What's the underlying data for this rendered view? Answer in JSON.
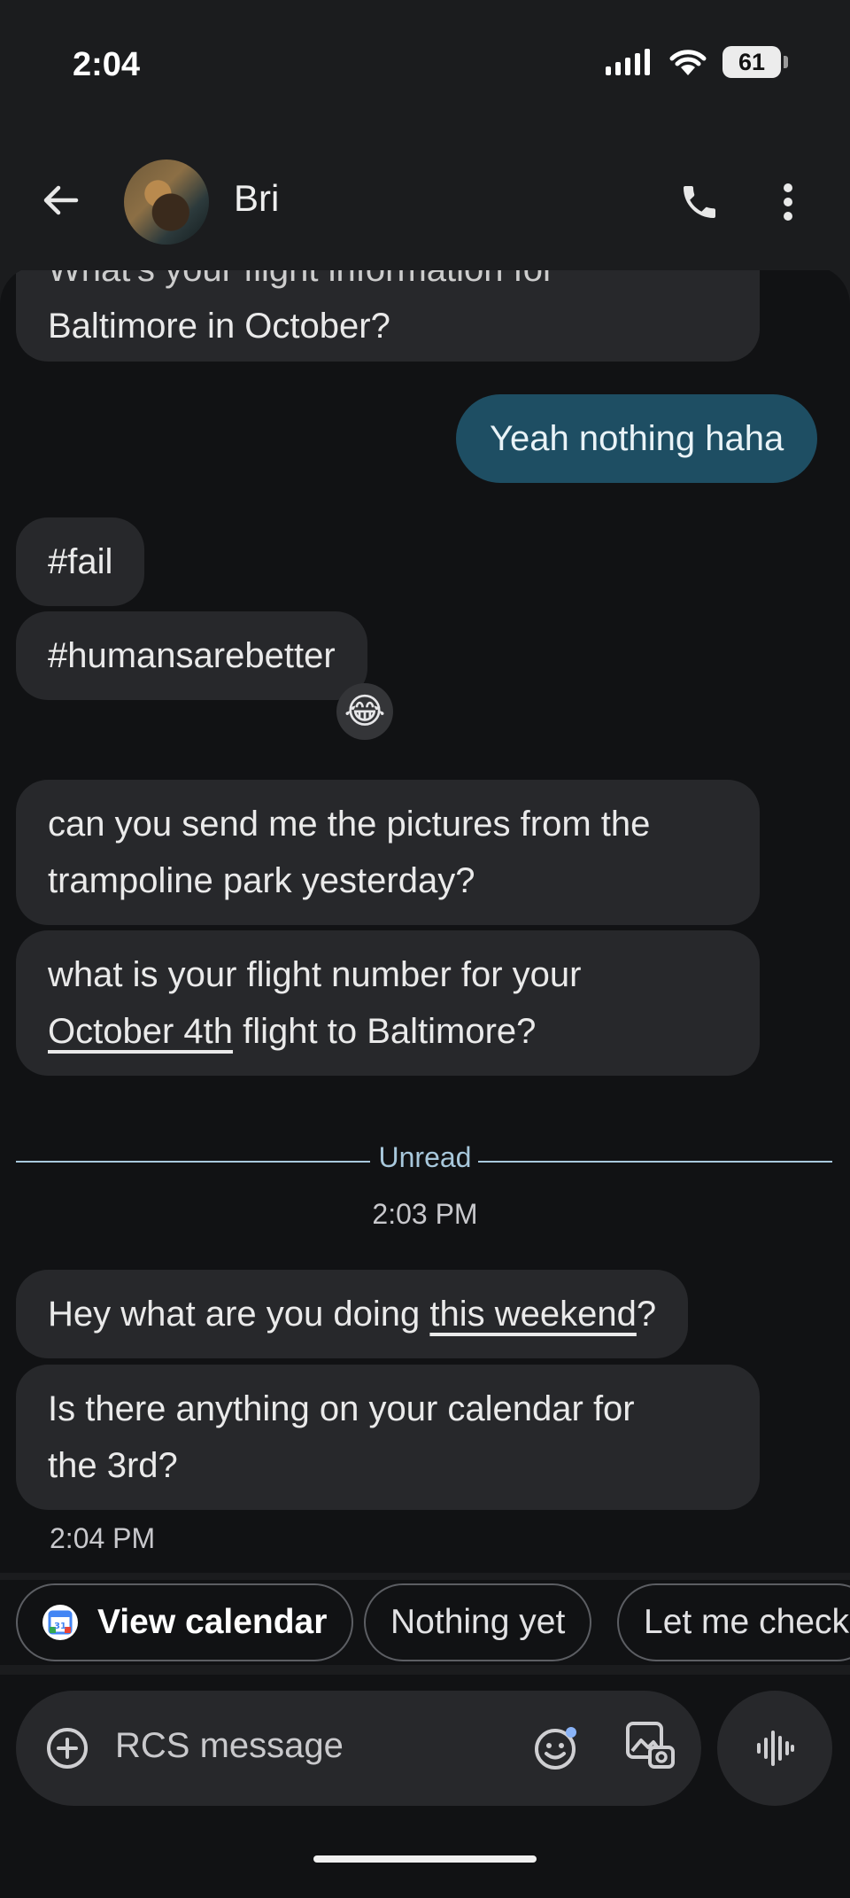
{
  "status_bar": {
    "time": "2:04",
    "battery": "61"
  },
  "header": {
    "contact_name": "Bri"
  },
  "messages": {
    "m1_partial": "What's your flight information for",
    "m1_line2": "Baltimore in October?",
    "outgoing_1": "Yeah nothing haha",
    "m2": "#fail",
    "m3": "#humansarebetter",
    "m3_reaction": "😂",
    "m4_line1": "can you send me the pictures from the",
    "m4_line2": "trampoline park yesterday?",
    "m5_line1": "what is your flight number for your",
    "m5_link": "October 4th",
    "m5_rest": " flight to Baltimore?",
    "unread_label": "Unread",
    "time_divider": "2:03 PM",
    "m6_pre": "Hey what are you doing ",
    "m6_link": "this weekend",
    "m6_post": "?",
    "m7_line1": "Is there anything on your calendar for",
    "m7_line2": "the 3rd?",
    "last_timestamp": "2:04 PM"
  },
  "suggestions": [
    {
      "label": "View calendar",
      "icon": "google-calendar-icon"
    },
    {
      "label": "Nothing yet"
    },
    {
      "label": "Let me check"
    }
  ],
  "compose": {
    "placeholder": "RCS message"
  },
  "colors": {
    "outgoing_bubble": "#1e4e63",
    "incoming_bubble": "#27282b",
    "unread_accent": "#a8c8dc"
  }
}
